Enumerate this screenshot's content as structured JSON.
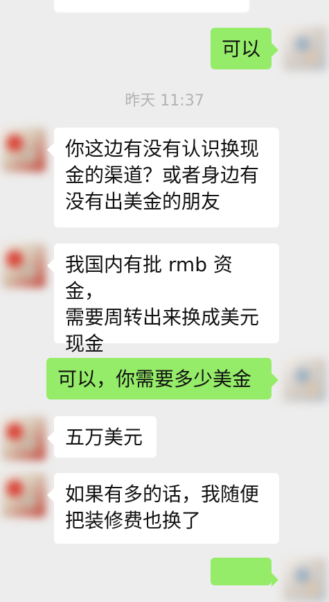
{
  "conversation": {
    "top_cropped_message": "",
    "self_message_1": "可以",
    "timestamp": "昨天 11:37",
    "other_message_1": "你这边有没有认识换现\n金的渠道？或者身边有\n没有出美金的朋友",
    "other_message_2": "我国内有批 rmb 资金，\n需要周转出来换成美元\n现金",
    "self_message_2": "可以，你需要多少美金",
    "other_message_3": "五万美元",
    "other_message_4": "如果有多的话，我随便\n把装修费也换了",
    "self_message_3": ""
  },
  "colors": {
    "background": "#ededed",
    "self_bubble": "#95ec69",
    "other_bubble": "#ffffff",
    "timestamp_text": "#b2b2b2"
  }
}
